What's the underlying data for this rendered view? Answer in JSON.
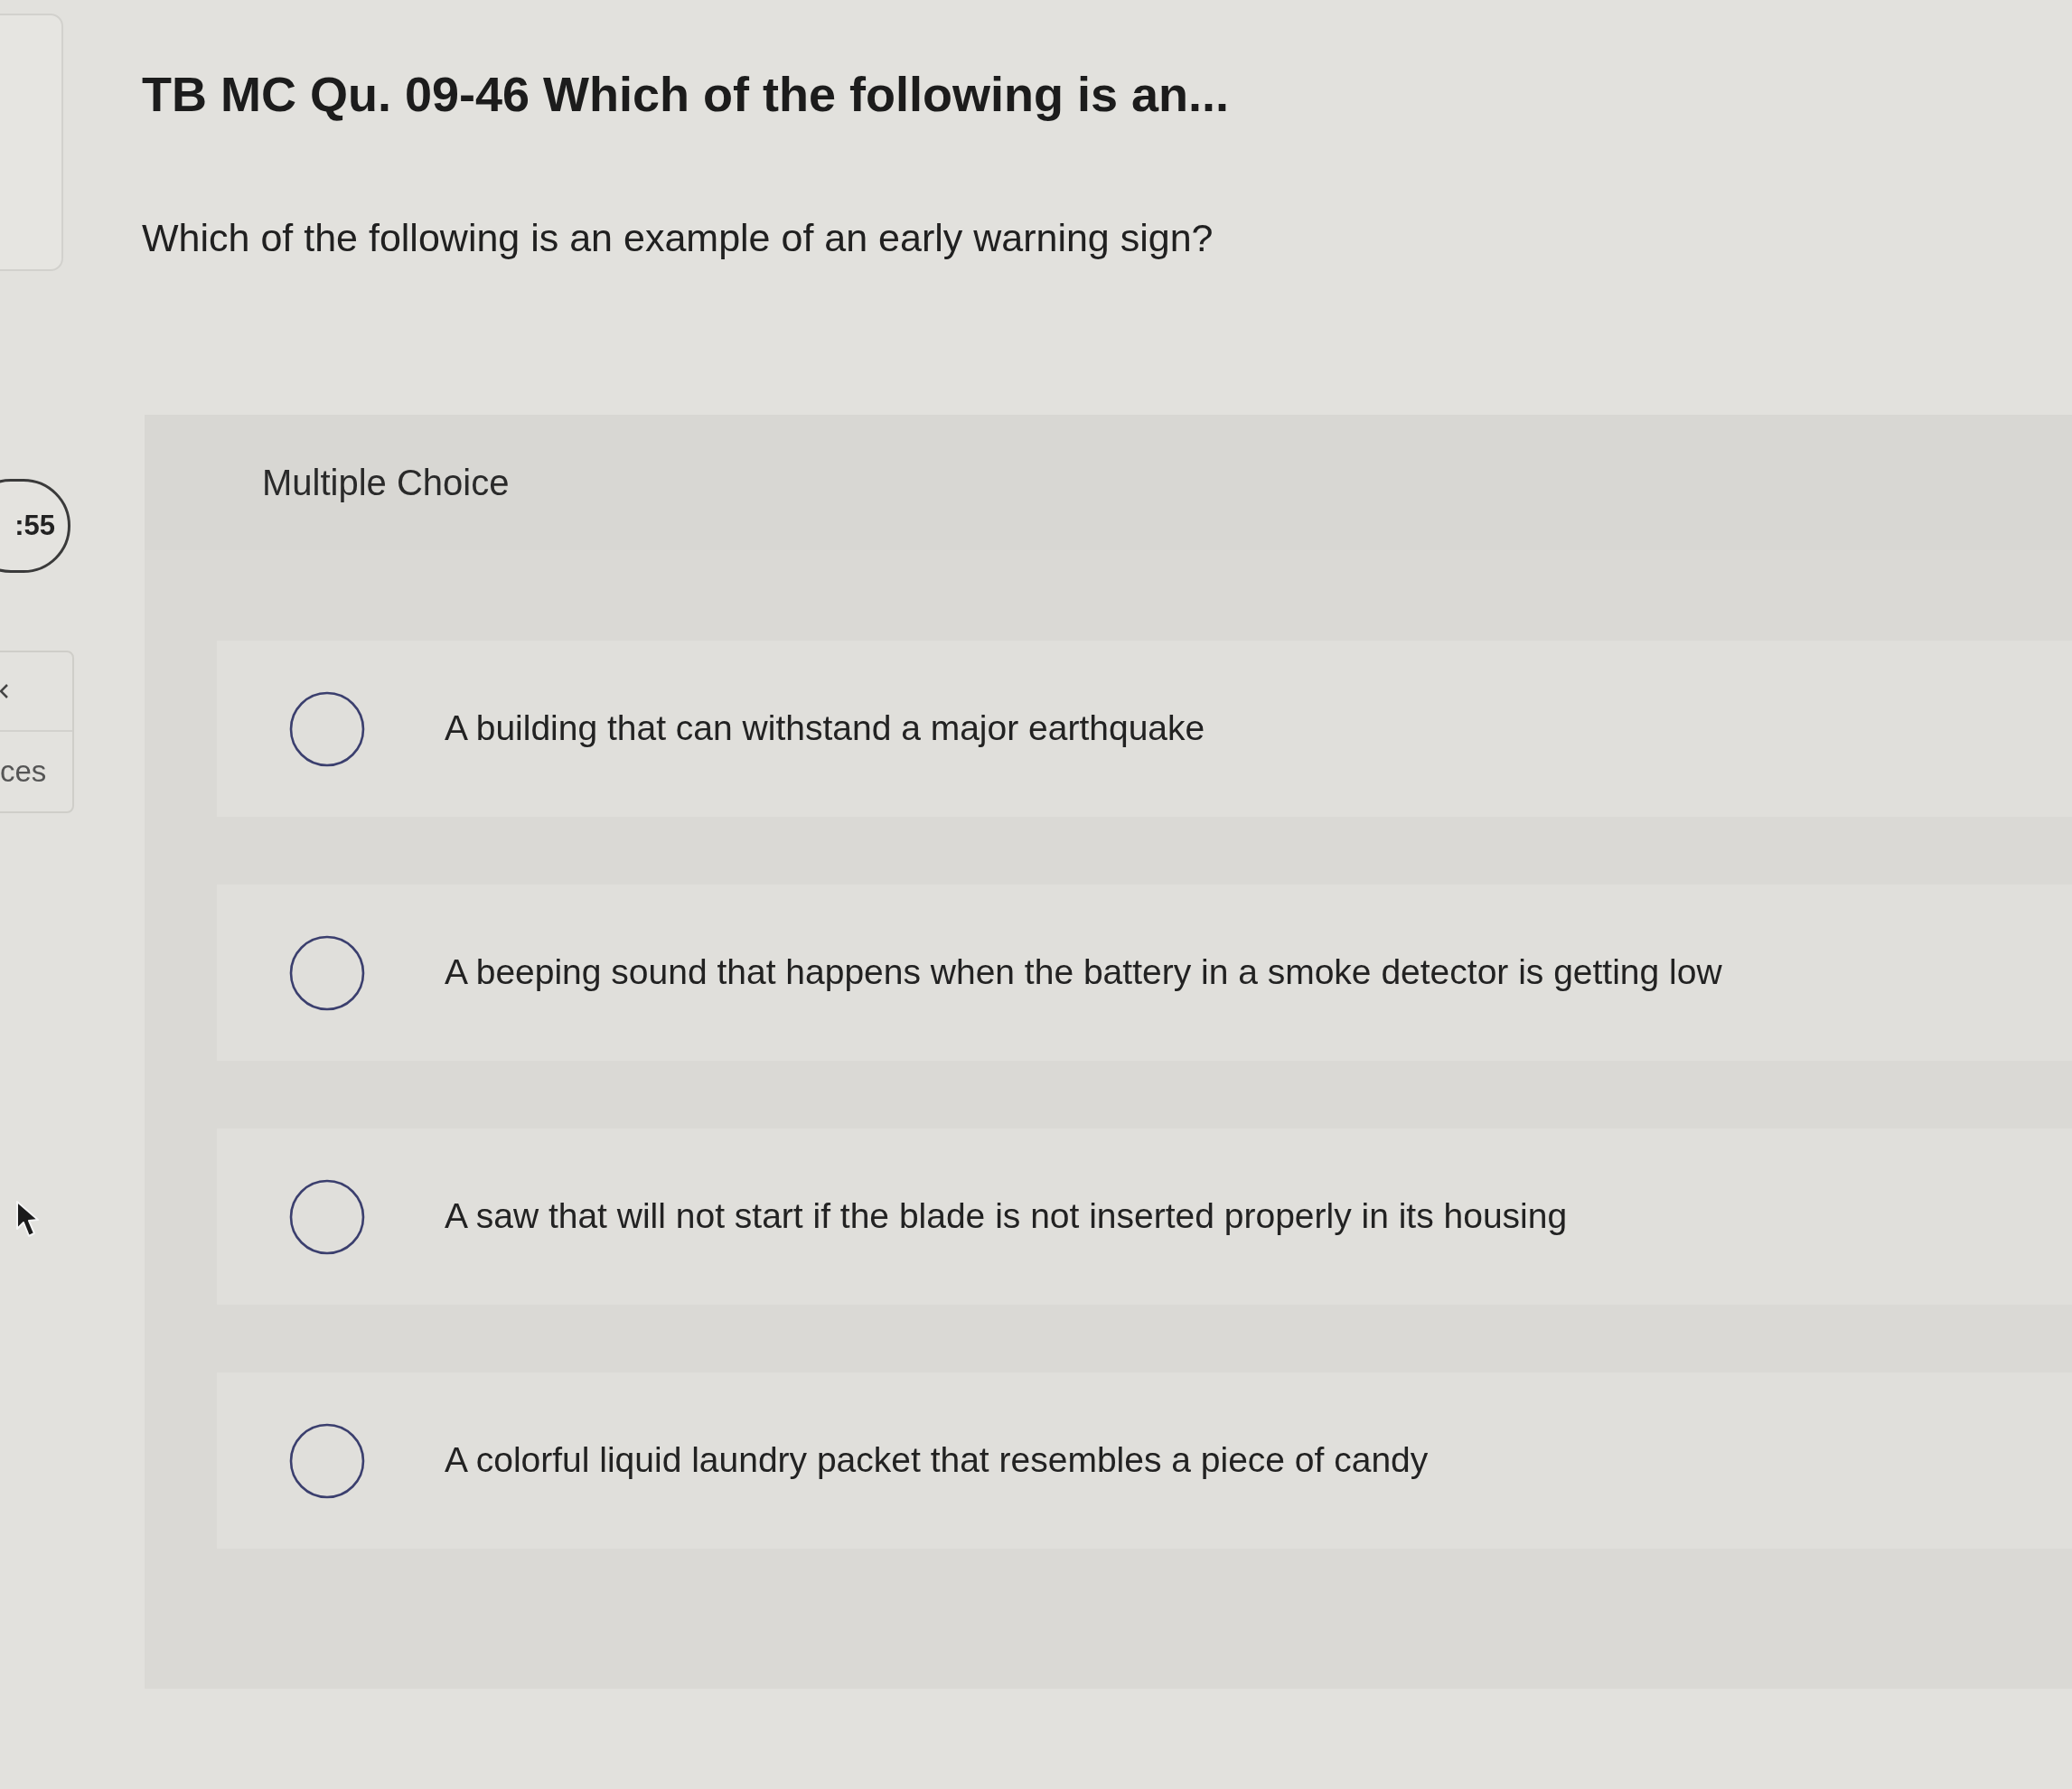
{
  "title": "TB MC Qu. 09-46 Which of the following is an...",
  "question": "Which of the following is an example of an early warning sign?",
  "sidebar": {
    "timer": ":55",
    "nav_label": "ces"
  },
  "answer_panel": {
    "type_label": "Multiple Choice",
    "options": [
      {
        "label": "A building that can withstand a major earthquake",
        "selected": false
      },
      {
        "label": "A beeping sound that happens when the battery in a smoke detector is getting low",
        "selected": false
      },
      {
        "label": "A saw that will not start if the blade is not inserted properly in its housing",
        "selected": false
      },
      {
        "label": "A colorful liquid laundry packet that resembles a piece of candy",
        "selected": false
      }
    ]
  }
}
